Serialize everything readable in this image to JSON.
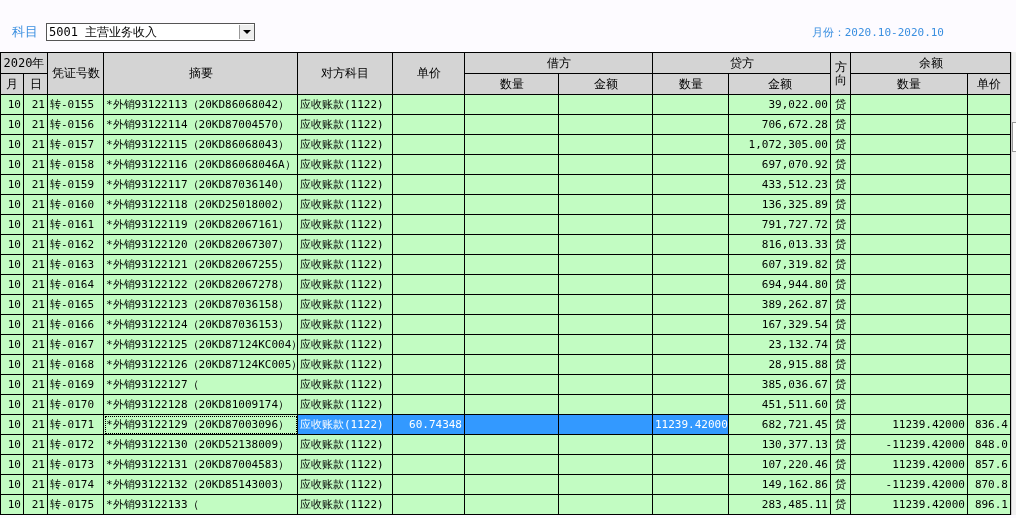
{
  "toolbar": {
    "account_label": "科目",
    "account_value": "5001 主营业务收入",
    "period": "月份：2020.10-2020.10"
  },
  "table": {
    "header": {
      "year": "2020年",
      "month": "月",
      "day": "日",
      "voucher": "凭证号数",
      "summary": "摘要",
      "account": "对方科目",
      "unit_price": "单价",
      "debit": "借方",
      "debit_qty": "数量",
      "debit_amount": "金额",
      "credit": "贷方",
      "credit_qty": "数量",
      "credit_amount": "金额",
      "direction": "方向",
      "balance": "余额",
      "balance_qty": "数量",
      "balance_price": "单价"
    },
    "rows": [
      {
        "month": "10",
        "day": "21",
        "voucher": "转-0155",
        "summary": "*外销93122113（20KD86068042）",
        "account": "应收账款(1122)",
        "credit_amount": "39,022.00",
        "direction": "贷",
        "selected": false
      },
      {
        "month": "10",
        "day": "21",
        "voucher": "转-0156",
        "summary": "*外销93122114（20KD87004570）",
        "account": "应收账款(1122)",
        "credit_amount": "706,672.28",
        "direction": "贷",
        "selected": false
      },
      {
        "month": "10",
        "day": "21",
        "voucher": "转-0157",
        "summary": "*外销93122115（20KD86068043）",
        "account": "应收账款(1122)",
        "credit_amount": "1,072,305.00",
        "direction": "贷",
        "selected": false
      },
      {
        "month": "10",
        "day": "21",
        "voucher": "转-0158",
        "summary": "*外销93122116（20KD86068046A）",
        "account": "应收账款(1122)",
        "credit_amount": "697,070.92",
        "direction": "贷",
        "selected": false
      },
      {
        "month": "10",
        "day": "21",
        "voucher": "转-0159",
        "summary": "*外销93122117（20KD87036140）",
        "account": "应收账款(1122)",
        "credit_amount": "433,512.23",
        "direction": "贷",
        "selected": false
      },
      {
        "month": "10",
        "day": "21",
        "voucher": "转-0160",
        "summary": "*外销93122118（20KD25018002）",
        "account": "应收账款(1122)",
        "credit_amount": "136,325.89",
        "direction": "贷",
        "selected": false
      },
      {
        "month": "10",
        "day": "21",
        "voucher": "转-0161",
        "summary": "*外销93122119（20KD82067161）",
        "account": "应收账款(1122)",
        "credit_amount": "791,727.72",
        "direction": "贷",
        "selected": false
      },
      {
        "month": "10",
        "day": "21",
        "voucher": "转-0162",
        "summary": "*外销93122120（20KD82067307）",
        "account": "应收账款(1122)",
        "credit_amount": "816,013.33",
        "direction": "贷",
        "selected": false
      },
      {
        "month": "10",
        "day": "21",
        "voucher": "转-0163",
        "summary": "*外销93122121（20KD82067255）",
        "account": "应收账款(1122)",
        "credit_amount": "607,319.82",
        "direction": "贷",
        "selected": false
      },
      {
        "month": "10",
        "day": "21",
        "voucher": "转-0164",
        "summary": "*外销93122122（20KD82067278）",
        "account": "应收账款(1122)",
        "credit_amount": "694,944.80",
        "direction": "贷",
        "selected": false
      },
      {
        "month": "10",
        "day": "21",
        "voucher": "转-0165",
        "summary": "*外销93122123（20KD87036158）",
        "account": "应收账款(1122)",
        "credit_amount": "389,262.87",
        "direction": "贷",
        "selected": false
      },
      {
        "month": "10",
        "day": "21",
        "voucher": "转-0166",
        "summary": "*外销93122124（20KD87036153）",
        "account": "应收账款(1122)",
        "credit_amount": "167,329.54",
        "direction": "贷",
        "selected": false
      },
      {
        "month": "10",
        "day": "21",
        "voucher": "转-0167",
        "summary": "*外销93122125（20KD87124KC004）",
        "account": "应收账款(1122)",
        "credit_amount": "23,132.74",
        "direction": "贷",
        "selected": false
      },
      {
        "month": "10",
        "day": "21",
        "voucher": "转-0168",
        "summary": "*外销93122126（20KD87124KC005）",
        "account": "应收账款(1122)",
        "credit_amount": "28,915.88",
        "direction": "贷",
        "selected": false
      },
      {
        "month": "10",
        "day": "21",
        "voucher": "转-0169",
        "summary": "*外销93122127（",
        "account": "应收账款(1122)",
        "credit_amount": "385,036.67",
        "direction": "贷",
        "selected": false
      },
      {
        "month": "10",
        "day": "21",
        "voucher": "转-0170",
        "summary": "*外销93122128（20KD81009174）",
        "account": "应收账款(1122)",
        "credit_amount": "451,511.60",
        "direction": "贷",
        "selected": false
      },
      {
        "month": "10",
        "day": "21",
        "voucher": "转-0171",
        "summary": "*外销93122129（20KD87003096）",
        "account": "应收账款(1122)",
        "unit_price": "60.74348",
        "credit_qty": "11239.42000",
        "credit_amount": "682,721.45",
        "direction": "贷",
        "balance_qty": "11239.42000",
        "balance_price": "836.4",
        "selected": true
      },
      {
        "month": "10",
        "day": "21",
        "voucher": "转-0172",
        "summary": "*外销93122130（20KD52138009）",
        "account": "应收账款(1122)",
        "credit_amount": "130,377.13",
        "direction": "贷",
        "balance_qty": "-11239.42000",
        "balance_price": "848.0",
        "selected": false
      },
      {
        "month": "10",
        "day": "21",
        "voucher": "转-0173",
        "summary": "*外销93122131（20KD87004583）",
        "account": "应收账款(1122)",
        "credit_amount": "107,220.46",
        "direction": "贷",
        "balance_qty": "11239.42000",
        "balance_price": "857.6",
        "selected": false
      },
      {
        "month": "10",
        "day": "21",
        "voucher": "转-0174",
        "summary": "*外销93122132（20KD85143003）",
        "account": "应收账款(1122)",
        "credit_amount": "149,162.86",
        "direction": "贷",
        "balance_qty": "-11239.42000",
        "balance_price": "870.8",
        "selected": false
      },
      {
        "month": "10",
        "day": "21",
        "voucher": "转-0175",
        "summary": "*外销93122133（",
        "account": "应收账款(1122)",
        "credit_amount": "283,485.11",
        "direction": "贷",
        "balance_qty": "11239.42000",
        "balance_price": "896.1",
        "selected": false
      }
    ]
  }
}
